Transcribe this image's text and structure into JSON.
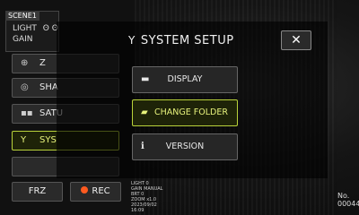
{
  "scene": {
    "title": "SCENE1",
    "line1": "LIGHT",
    "line1_tail": "ʘ  ʘ",
    "line2": "GAIN"
  },
  "sidebar": {
    "items": [
      {
        "label": "Z",
        "icon": "zoom-icon"
      },
      {
        "label": "SHA",
        "icon": "shading-icon"
      },
      {
        "label": "SATU",
        "icon": "saturation-icon"
      },
      {
        "label": "SYS",
        "icon": "tool-icon",
        "active": true
      },
      {
        "label": "",
        "icon": ""
      }
    ]
  },
  "bottom": {
    "freeze_label": "FRZ",
    "rec_label": "REC"
  },
  "info_lines": [
    "LIGHT 0",
    "GAIN MANUAL",
    "BRT 0",
    "ZOOM x1.0",
    "2023/09/02",
    "16:09"
  ],
  "counter": {
    "label": "No.",
    "value": "00044"
  },
  "dialog": {
    "title": "SYSTEM SETUP",
    "title_icon": "tool-icon",
    "close_label": "✕",
    "buttons": [
      {
        "label": "DISPLAY",
        "icon": "display-icon"
      },
      {
        "label": "CHANGE FOLDER",
        "icon": "folder-icon",
        "active": true
      },
      {
        "label": "VERSION",
        "icon": "info-icon"
      }
    ]
  },
  "colors": {
    "accent": "#b9d23a",
    "rec": "#ff5a1f"
  }
}
